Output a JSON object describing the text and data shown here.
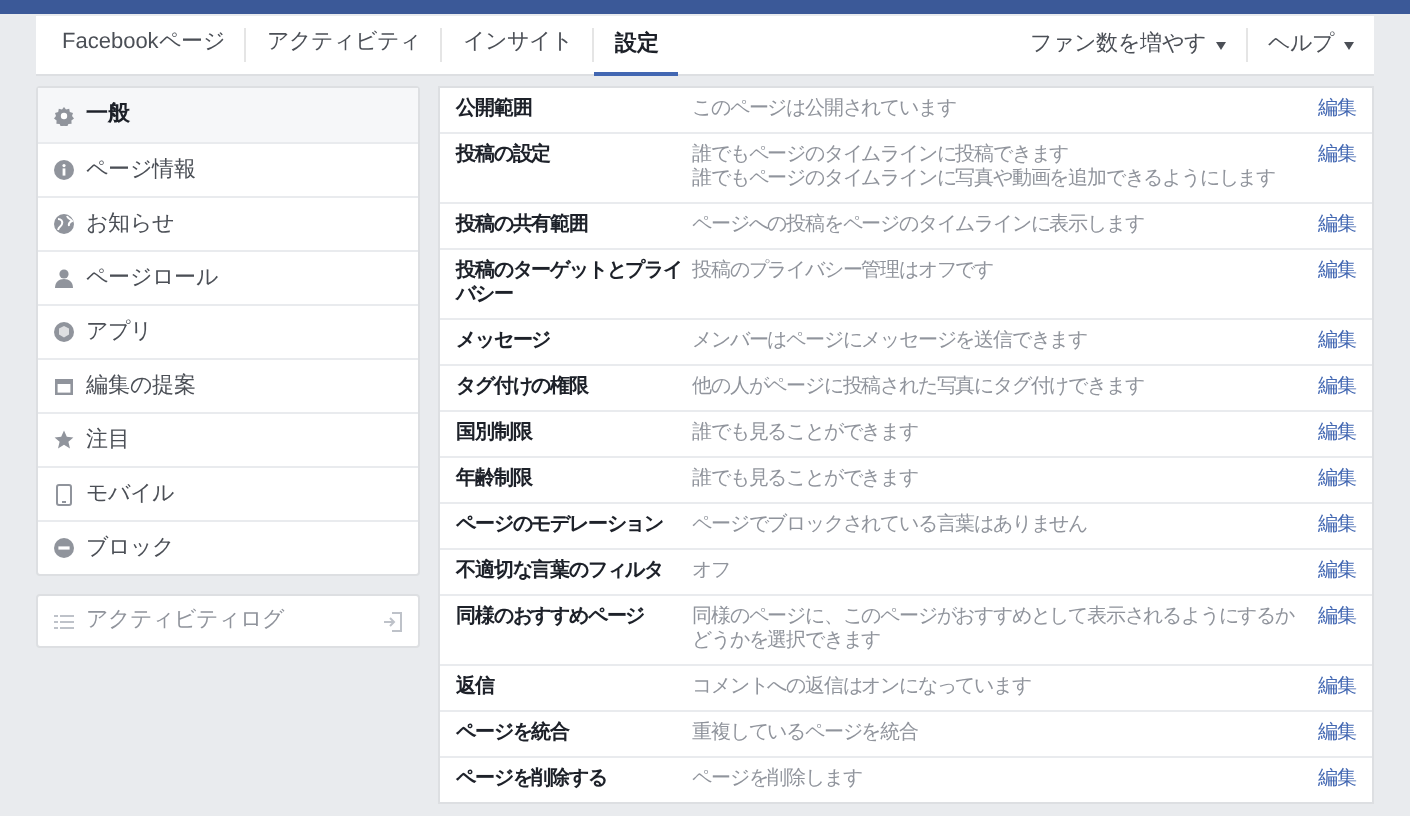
{
  "nav": {
    "tabs": [
      {
        "label": "Facebookページ",
        "selected": false
      },
      {
        "label": "アクティビティ",
        "selected": false
      },
      {
        "label": "インサイト",
        "selected": false
      },
      {
        "label": "設定",
        "selected": true
      }
    ],
    "menus": [
      "ファン数を増やす",
      "ヘルプ"
    ]
  },
  "sidebar": {
    "items": [
      {
        "label": "一般",
        "selected": true
      },
      {
        "label": "ページ情報",
        "selected": false
      },
      {
        "label": "お知らせ",
        "selected": false
      },
      {
        "label": "ページロール",
        "selected": false
      },
      {
        "label": "アプリ",
        "selected": false
      },
      {
        "label": "編集の提案",
        "selected": false
      },
      {
        "label": "注目",
        "selected": false
      },
      {
        "label": "モバイル",
        "selected": false
      },
      {
        "label": "ブロック",
        "selected": false
      }
    ],
    "activity_log": "アクティビティログ"
  },
  "settings": [
    {
      "label": "公開範囲",
      "value": [
        "このページは公開されています"
      ],
      "action": "編集"
    },
    {
      "label": "投稿の設定",
      "value": [
        "誰でもページのタイムラインに投稿できます",
        "誰でもページのタイムラインに写真や動画を追加できるようにします"
      ],
      "action": "編集"
    },
    {
      "label": "投稿の共有範囲",
      "value": [
        "ページへの投稿をページのタイムラインに表示します"
      ],
      "action": "編集"
    },
    {
      "label": "投稿のターゲットとプライバシー",
      "value": [
        "投稿のプライバシー管理はオフです"
      ],
      "action": "編集"
    },
    {
      "label": "メッセージ",
      "value": [
        "メンバーはページにメッセージを送信できます"
      ],
      "action": "編集"
    },
    {
      "label": "タグ付けの権限",
      "value": [
        "他の人がページに投稿された写真にタグ付けできます"
      ],
      "action": "編集"
    },
    {
      "label": "国別制限",
      "value": [
        "誰でも見ることができます"
      ],
      "action": "編集"
    },
    {
      "label": "年齢制限",
      "value": [
        "誰でも見ることができます"
      ],
      "action": "編集"
    },
    {
      "label": "ページのモデレーション",
      "value": [
        "ページでブロックされている言葉はありません"
      ],
      "action": "編集"
    },
    {
      "label": "不適切な言葉のフィルタ",
      "value": [
        "オフ"
      ],
      "action": "編集"
    },
    {
      "label": "同様のおすすめページ",
      "value": [
        "同様のページに、このページがおすすめとして表示されるようにするかどうかを選択できます"
      ],
      "action": "編集"
    },
    {
      "label": "返信",
      "value": [
        "コメントへの返信はオンになっています"
      ],
      "action": "編集"
    },
    {
      "label": "ページを統合",
      "value": [
        "重複しているページを統合"
      ],
      "action": "編集"
    },
    {
      "label": "ページを削除する",
      "value": [
        "ページを削除します"
      ],
      "action": "編集"
    }
  ]
}
